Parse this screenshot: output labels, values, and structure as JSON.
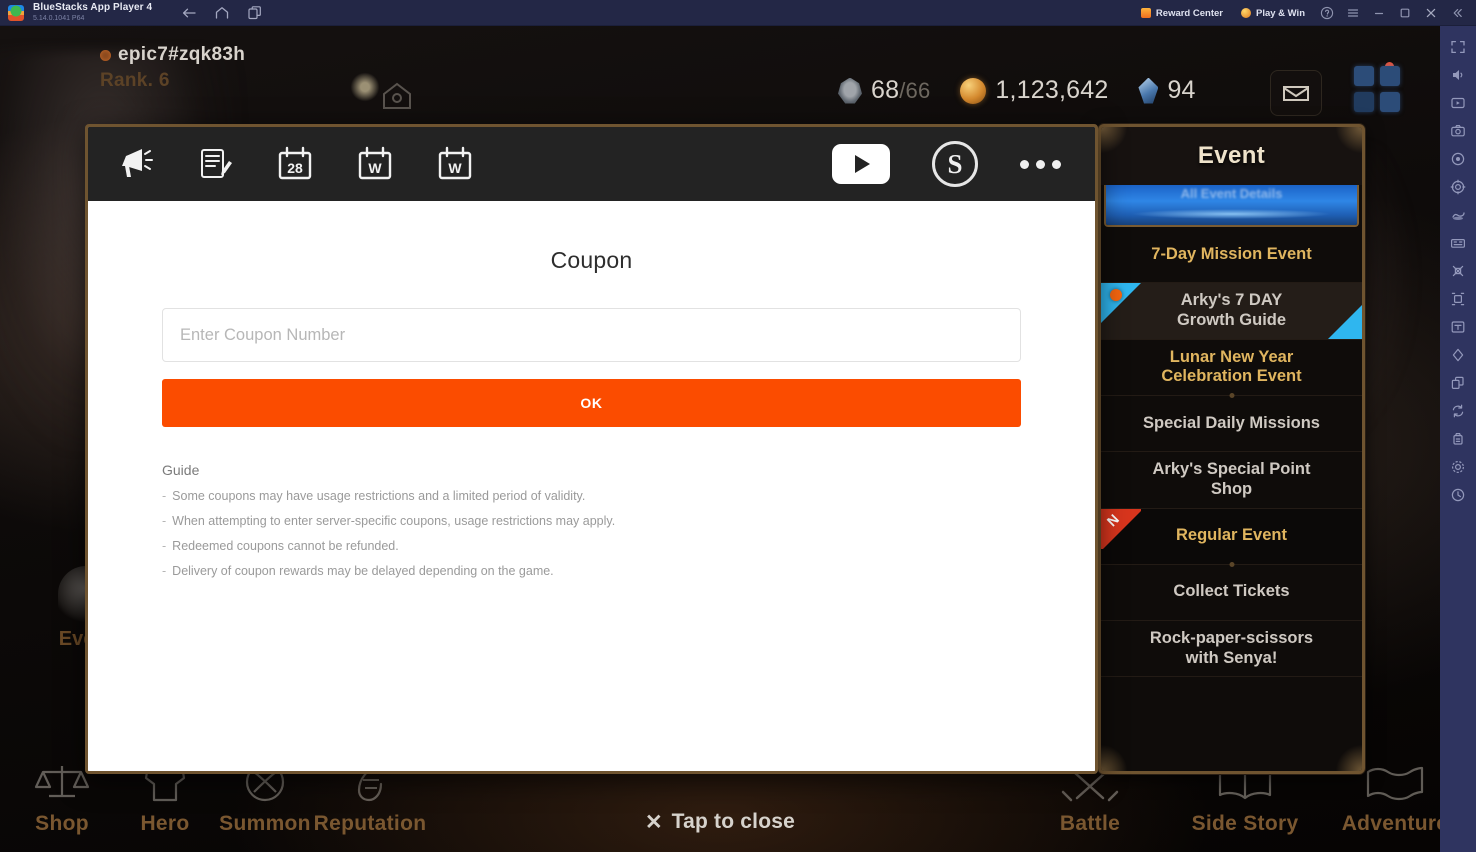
{
  "window": {
    "title": "BlueStacks App Player 4",
    "subtitle": "5.14.0.1041 P64",
    "nav": {
      "back": "back-arrow",
      "home": "home",
      "multi": "multi-instance"
    },
    "reward_center": "Reward Center",
    "play_and_win": "Play & Win",
    "controls": [
      "help",
      "menu",
      "minimize",
      "maximize",
      "close",
      "collapse"
    ]
  },
  "game_hud": {
    "player_name": "epic7#zqk83h",
    "rank": "Rank. 6",
    "energy": "68",
    "energy_max": "/66",
    "gold": "1,123,642",
    "skystone": "94"
  },
  "event_label": "Event",
  "bottom_nav": [
    {
      "label": "Shop",
      "icon": "scales-icon"
    },
    {
      "label": "Hero",
      "icon": "helmet-icon"
    },
    {
      "label": "Summon",
      "icon": "portal-icon"
    },
    {
      "label": "Reputation",
      "icon": "feather-icon"
    },
    {
      "label": "Battle",
      "icon": "crossed-swords-icon"
    },
    {
      "label": "Side Story",
      "icon": "open-book-icon"
    },
    {
      "label": "Adventure",
      "icon": "map-scroll-icon"
    }
  ],
  "tap_to_close": {
    "x": "✕",
    "label": "Tap to close"
  },
  "modal": {
    "toolbar_left": [
      {
        "name": "megaphone-icon"
      },
      {
        "name": "notice-board-icon"
      },
      {
        "name": "calendar-28-icon",
        "text": "28"
      },
      {
        "name": "calendar-w-icon",
        "text": "W"
      },
      {
        "name": "calendar-w2-icon",
        "text": "W"
      }
    ],
    "toolbar_right": [
      {
        "name": "youtube-icon"
      },
      {
        "name": "stove-s-icon",
        "text": "S"
      },
      {
        "name": "more-options-icon"
      }
    ],
    "title": "Coupon",
    "input_placeholder": "Enter Coupon Number",
    "input_value": "",
    "ok_label": "OK",
    "guide_title": "Guide",
    "guide_lines": [
      "Some coupons may have usage restrictions and a limited period of validity.",
      "When attempting to enter server-specific coupons, usage restrictions may apply.",
      "Redeemed coupons cannot be refunded.",
      "Delivery of coupon rewards may be delayed depending on the game."
    ]
  },
  "event_panel": {
    "title": "Event",
    "banner_text": "All Event Details",
    "items": [
      {
        "label": "7-Day Mission Event",
        "style": "gold",
        "badge": ""
      },
      {
        "label": "Arky's 7 DAY\nGrowth Guide",
        "style": "sel",
        "badge": "new"
      },
      {
        "label": "Lunar New Year\nCelebration Event",
        "style": "gold",
        "badge": ""
      },
      {
        "label": "Special Daily Missions",
        "style": "",
        "badge": ""
      },
      {
        "label": "Arky's Special Point\nShop",
        "style": "",
        "badge": ""
      },
      {
        "label": "Regular Event",
        "style": "gold dark",
        "badge": "n"
      },
      {
        "label": "Collect Tickets",
        "style": "",
        "badge": ""
      },
      {
        "label": "Rock-paper-scissors\nwith Senya!",
        "style": "",
        "badge": ""
      }
    ]
  },
  "rail_icons": [
    "fullscreen-icon",
    "volume-icon",
    "video-recorder-icon",
    "screenshot-icon",
    "record-macro-icon",
    "location-icon",
    "shake-icon",
    "multi-instance-icon",
    "eco-mode-icon",
    "keymapping-icon",
    "real-time-translation-icon",
    "trim-memory-icon",
    "rotate-icon",
    "copy-icon",
    "sync-icon",
    "apk-install-icon",
    "settings-gear-icon",
    "clock-icon"
  ],
  "colors": {
    "accent_orange": "#fb4c00",
    "panel_gold": "#e0b55f",
    "titlebar": "#232746",
    "rail": "#2f3460"
  }
}
